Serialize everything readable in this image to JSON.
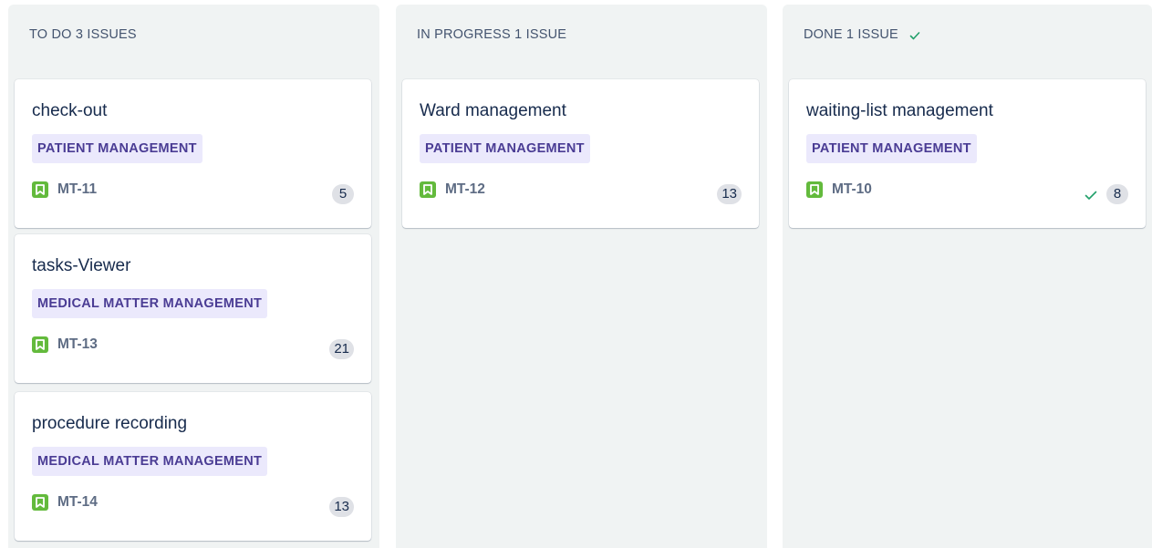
{
  "colors": {
    "column_bg": "#f0f3f3",
    "epic_bg": "#ebe9fc",
    "epic_text": "#4a3c94",
    "story_icon": "#63ba3c",
    "done_check": "#22a06b"
  },
  "columns": [
    {
      "header": "TO DO 3 ISSUES",
      "cards": [
        {
          "title": "check-out",
          "epic": "PATIENT MANAGEMENT",
          "key": "MT-11",
          "points": "5",
          "icon": "story-icon"
        },
        {
          "title": "tasks-Viewer",
          "epic": "MEDICAL MATTER MANAGEMENT",
          "key": "MT-13",
          "points": "21",
          "icon": "story-icon"
        },
        {
          "title": "procedure recording",
          "epic": "MEDICAL MATTER MANAGEMENT",
          "key": "MT-14",
          "points": "13",
          "icon": "story-icon"
        }
      ]
    },
    {
      "header": "IN PROGRESS 1 ISSUE",
      "cards": [
        {
          "title": "Ward management",
          "epic": "PATIENT MANAGEMENT",
          "key": "MT-12",
          "points": "13",
          "icon": "story-icon"
        }
      ]
    },
    {
      "header": "DONE 1 ISSUE",
      "header_icon": "checkmark-icon",
      "cards": [
        {
          "title": "waiting-list management",
          "epic": "PATIENT MANAGEMENT",
          "key": "MT-10",
          "points": "8",
          "icon": "story-icon",
          "resolved_icon": "checkmark-icon"
        }
      ]
    }
  ]
}
